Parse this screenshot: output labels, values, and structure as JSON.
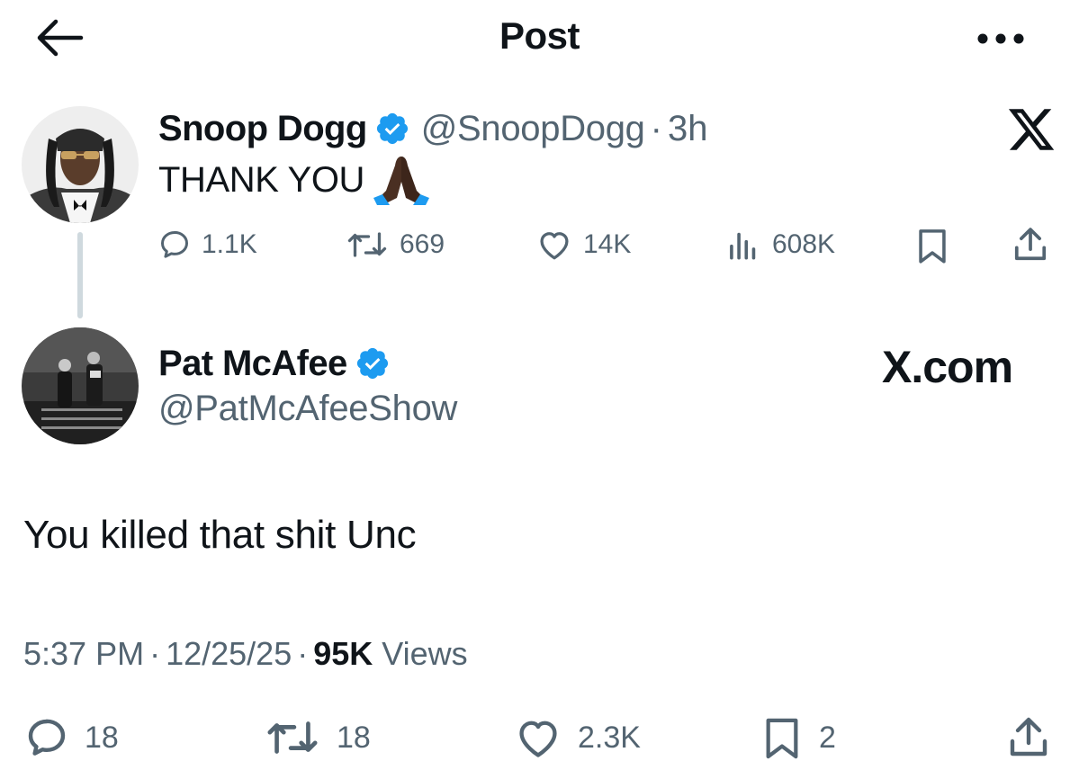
{
  "header": {
    "title": "Post",
    "back_icon": "arrow-left-icon",
    "more_icon": "ellipsis-icon"
  },
  "parent_post": {
    "display_name": "Snoop Dogg",
    "handle": "@SnoopDogg",
    "separator": "·",
    "time_ago": "3h",
    "text": "THANK YOU",
    "emoji": "folded-hands-emoji",
    "stats": {
      "replies": "1.1K",
      "reposts": "669",
      "likes": "14K",
      "views": "608K"
    }
  },
  "main_post": {
    "display_name": "Pat McAfee",
    "handle": "@PatMcAfeeShow",
    "watermark": "X.com",
    "text": "You killed that shit Unc",
    "timestamp_time": "5:37 PM",
    "separator": "·",
    "timestamp_date": "12/25/25",
    "views_count": "95K",
    "views_label": "Views",
    "stats": {
      "replies": "18",
      "reposts": "18",
      "likes": "2.3K",
      "bookmarks": "2"
    }
  },
  "colors": {
    "text_primary": "#0f1419",
    "text_secondary": "#536471",
    "verified_blue": "#1d9bf0",
    "thread_line": "#cfd9de"
  }
}
